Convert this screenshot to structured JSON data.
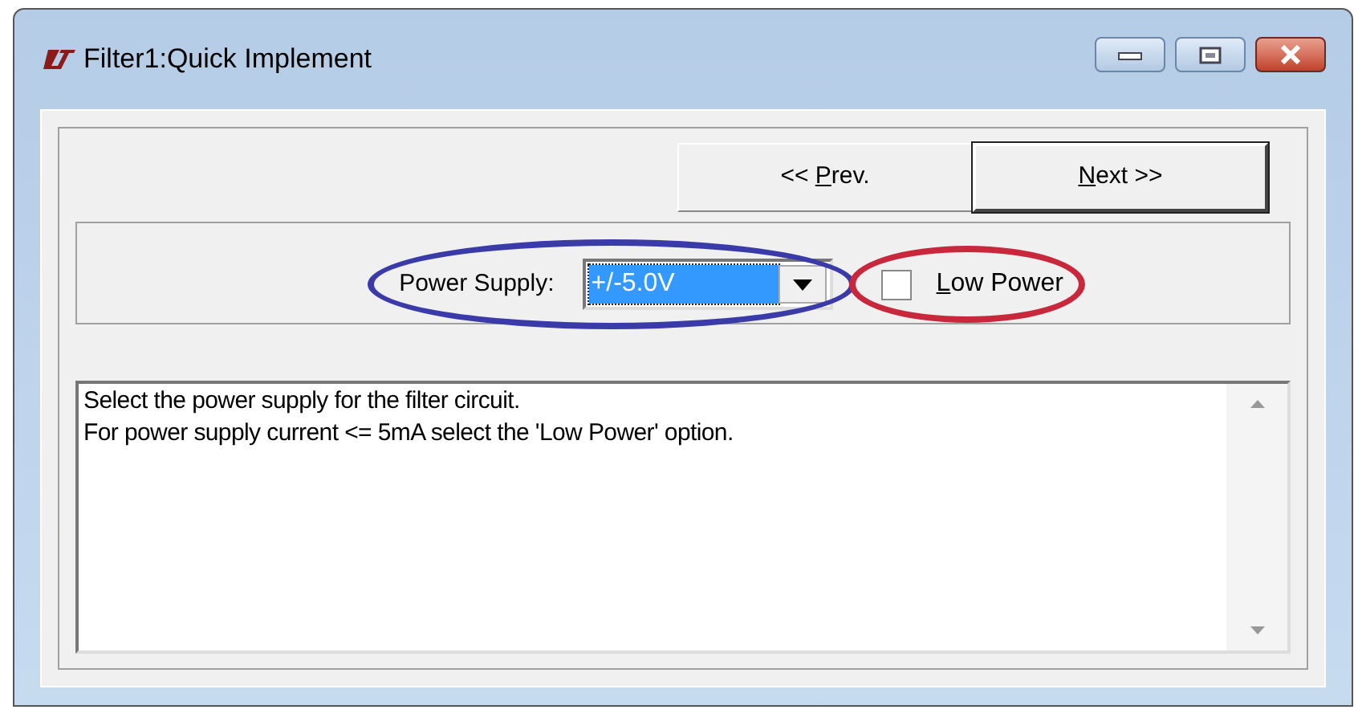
{
  "window": {
    "title": "Filter1:Quick Implement",
    "controls": [
      {
        "kind": "minimize"
      },
      {
        "kind": "maximize"
      },
      {
        "kind": "close"
      }
    ]
  },
  "nav_buttons": [
    {
      "label": {
        "before": "<< ",
        "key": "P",
        "after": "rev."
      },
      "default": false
    },
    {
      "label": {
        "key": "N",
        "after": "ext >>"
      },
      "default": true
    }
  ],
  "power_supply": {
    "label": "Power Supply:",
    "value": "+/-5.0V",
    "focused": true,
    "annotation": {
      "color": "#3a3aa8"
    }
  },
  "low_power": {
    "label": {
      "key": "L",
      "after": "ow Power"
    },
    "checked": false,
    "annotation": {
      "color": "#c8283c"
    }
  },
  "help_text": [
    "Select the power supply for the filter circuit.",
    "For power supply current <= 5mA select the 'Low Power' option."
  ]
}
